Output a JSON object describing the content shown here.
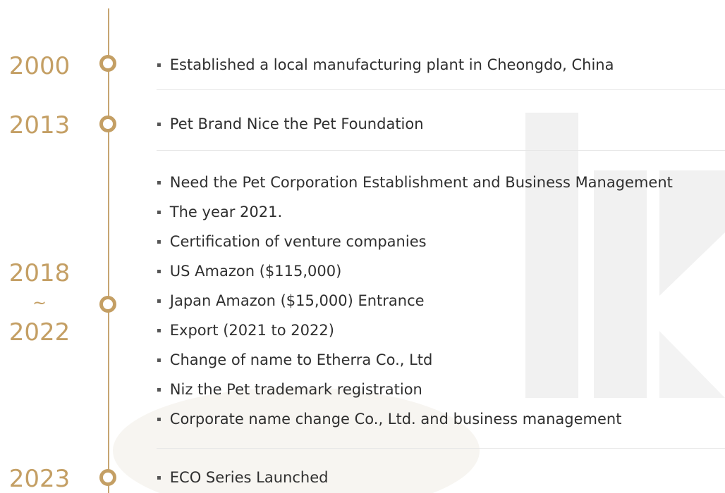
{
  "colors": {
    "accent": "#c49f64",
    "line": "#c6a572",
    "text": "#2f2f2f"
  },
  "timeline": [
    {
      "year": "2000",
      "items": [
        "Established a local manufacturing plant in Cheongdo, China"
      ]
    },
    {
      "year": "2013",
      "items": [
        "Pet Brand Nice the Pet Foundation"
      ]
    },
    {
      "year_start": "2018",
      "year_sep": "~",
      "year_end": "2022",
      "items": [
        "Need the Pet Corporation Establishment and Business Management",
        "The year 2021.",
        "Certification of venture companies",
        "US Amazon ($115,000)",
        "Japan Amazon ($15,000) Entrance",
        "Export (2021 to 2022)",
        "Change of name to Etherra Co., Ltd",
        "Niz the Pet trademark registration",
        "Corporate name change Co., Ltd. and business management"
      ]
    },
    {
      "year": "2023",
      "items": [
        "ECO Series Launched"
      ]
    }
  ]
}
